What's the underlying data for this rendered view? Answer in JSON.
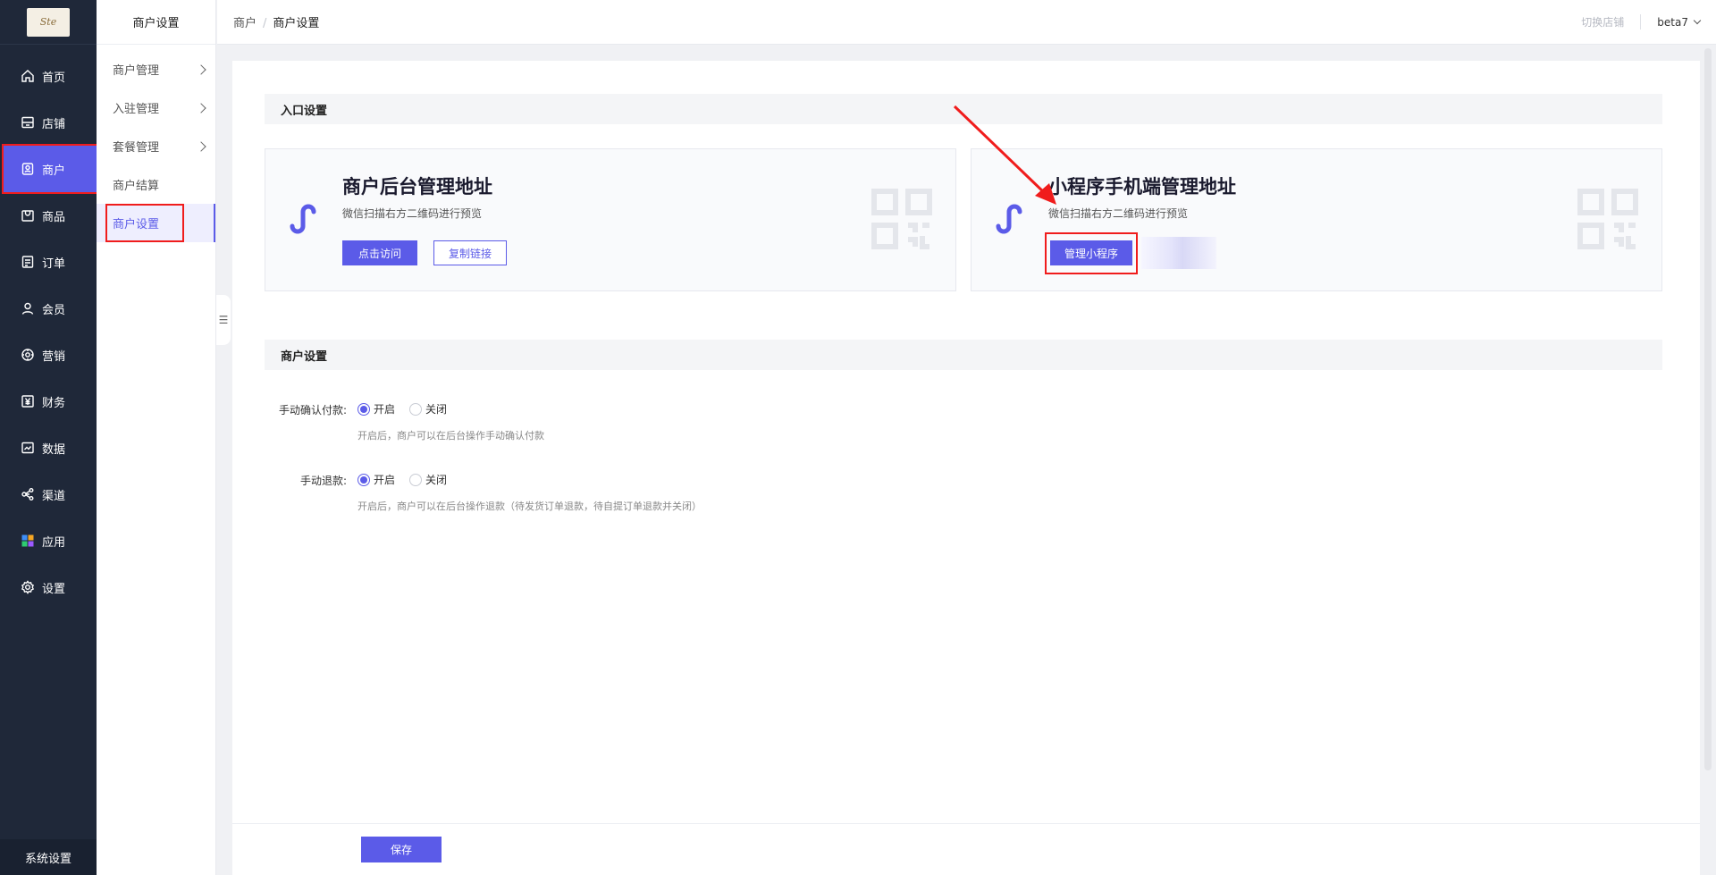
{
  "sidebar": {
    "logo_text": "Ste",
    "items": [
      {
        "label": "首页",
        "icon": "home-icon"
      },
      {
        "label": "店铺",
        "icon": "store-icon"
      },
      {
        "label": "商户",
        "icon": "merchant-icon"
      },
      {
        "label": "商品",
        "icon": "goods-icon"
      },
      {
        "label": "订单",
        "icon": "order-icon"
      },
      {
        "label": "会员",
        "icon": "member-icon"
      },
      {
        "label": "营销",
        "icon": "marketing-icon"
      },
      {
        "label": "财务",
        "icon": "finance-icon"
      },
      {
        "label": "数据",
        "icon": "data-icon"
      },
      {
        "label": "渠道",
        "icon": "channel-icon"
      },
      {
        "label": "应用",
        "icon": "apps-icon"
      },
      {
        "label": "设置",
        "icon": "settings-icon"
      }
    ],
    "active_index": 2,
    "footer": "系统设置"
  },
  "submenu": {
    "title": "商户设置",
    "items": [
      {
        "label": "商户管理",
        "has_children": true
      },
      {
        "label": "入驻管理",
        "has_children": true
      },
      {
        "label": "套餐管理",
        "has_children": true
      },
      {
        "label": "商户结算",
        "has_children": false
      },
      {
        "label": "商户设置",
        "has_children": false
      }
    ],
    "active_index": 4
  },
  "header": {
    "breadcrumb": [
      "商户",
      "商户设置"
    ],
    "switch_store": "切换店铺",
    "version": "beta7"
  },
  "entry": {
    "section_title": "入口设置",
    "cards": [
      {
        "title": "商户后台管理地址",
        "desc": "微信扫描右方二维码进行预览",
        "primary_label": "点击访问",
        "secondary_label": "复制链接"
      },
      {
        "title": "小程序手机端管理地址",
        "desc": "微信扫描右方二维码进行预览",
        "primary_label": "管理小程序"
      }
    ]
  },
  "settings": {
    "section_title": "商户设置",
    "rows": [
      {
        "label": "手动确认付款:",
        "on_label": "开启",
        "off_label": "关闭",
        "selected": "开启",
        "hint": "开启后，商户可以在后台操作手动确认付款"
      },
      {
        "label": "手动退款:",
        "on_label": "开启",
        "off_label": "关闭",
        "selected": "开启",
        "hint": "开启后，商户可以在后台操作退款（待发货订单退款，待自提订单退款并关闭）"
      }
    ]
  },
  "footer": {
    "save_label": "保存"
  },
  "colors": {
    "accent": "#5b5be8",
    "sidebar_bg": "#1f2839",
    "highlight": "#f01c1c"
  }
}
